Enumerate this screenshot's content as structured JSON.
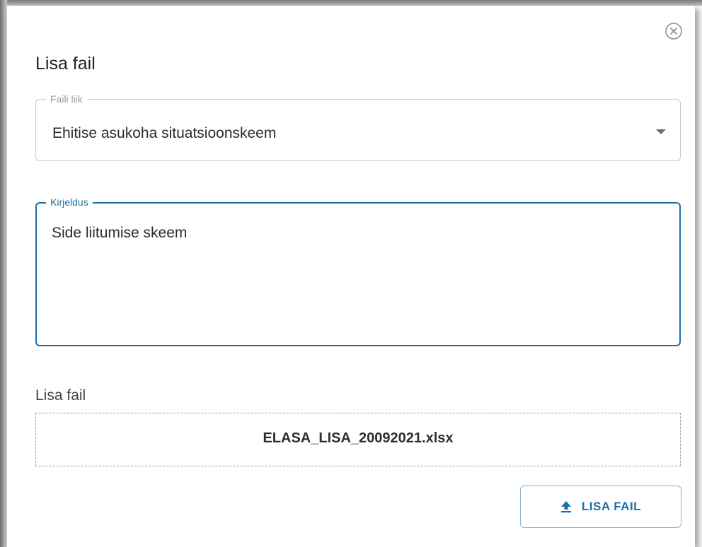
{
  "dialog": {
    "title": "Lisa fail",
    "close_icon": "close-circle-icon"
  },
  "file_type": {
    "label": "Faili liik",
    "selected": "Ehitise asukoha situatsioonskeem",
    "caret_icon": "caret-down-icon"
  },
  "description": {
    "label": "Kirjeldus",
    "value": "Side liitumise skeem"
  },
  "attachment": {
    "label": "Lisa fail",
    "file_name": "ELASA_LISA_20092021.xlsx"
  },
  "upload_button": {
    "label": "LISA FAIL",
    "icon": "upload-icon"
  },
  "colors": {
    "accent": "#1a6fa8",
    "text": "#2b2b2b",
    "border": "#c9c9c9"
  }
}
